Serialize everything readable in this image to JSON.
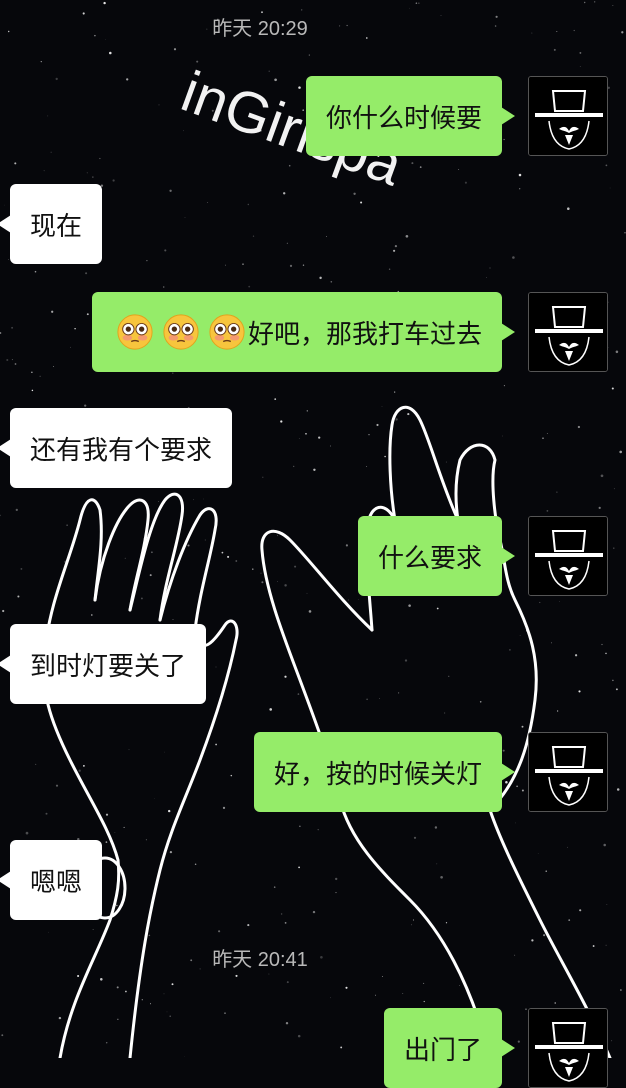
{
  "watermark": "inGirlspa",
  "timestamps": {
    "first": "昨天 20:29",
    "second": "昨天 20:41"
  },
  "messages": [
    {
      "sender": "me",
      "text": "你什么时候要"
    },
    {
      "sender": "them",
      "text": "现在"
    },
    {
      "sender": "me",
      "emojis": [
        "flushed-face",
        "flushed-face",
        "flushed-face"
      ],
      "text": "好吧，那我打车过去"
    },
    {
      "sender": "them",
      "text": "还有我有个要求"
    },
    {
      "sender": "me",
      "text": "什么要求"
    },
    {
      "sender": "them",
      "text": "到时灯要关了"
    },
    {
      "sender": "me",
      "text": "好，按的时候关灯"
    },
    {
      "sender": "them",
      "text": "嗯嗯"
    },
    {
      "sender": "me",
      "text": "出门了"
    }
  ],
  "colors": {
    "my_bubble": "#95ec69",
    "their_bubble": "#ffffff",
    "background": "#06070b",
    "timestamp": "#b9b9b9"
  },
  "avatar_icon": "masked-figure-hat-avatar"
}
